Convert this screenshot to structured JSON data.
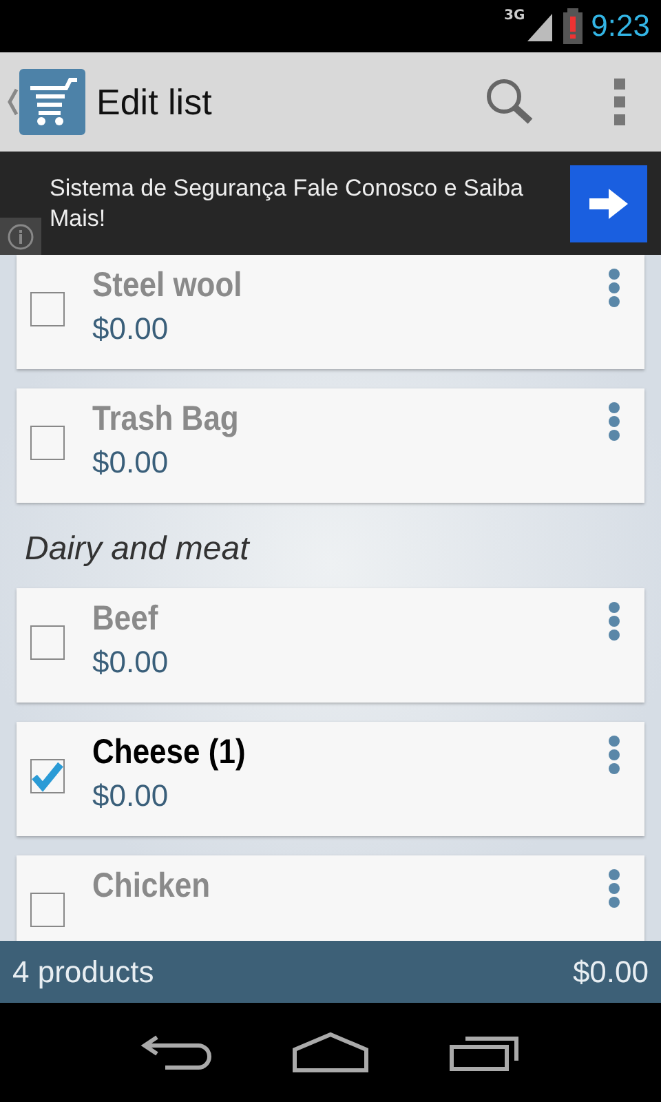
{
  "status_bar": {
    "network": "3G",
    "time": "9:23"
  },
  "action_bar": {
    "title": "Edit list"
  },
  "ad": {
    "text": "Sistema de Segurança Fale Conosco e Saiba Mais!"
  },
  "sections": [
    {
      "items": [
        {
          "name": "Steel wool",
          "price": "$0.00",
          "checked": false
        },
        {
          "name": "Trash Bag",
          "price": "$0.00",
          "checked": false
        }
      ]
    },
    {
      "title": "Dairy and meat",
      "items": [
        {
          "name": "Beef",
          "price": "$0.00",
          "checked": false
        },
        {
          "name": "Cheese (1)",
          "price": "$0.00",
          "checked": true
        },
        {
          "name": "Chicken",
          "checked": false
        }
      ]
    }
  ],
  "footer": {
    "count": "4 products",
    "total": "$0.00"
  }
}
